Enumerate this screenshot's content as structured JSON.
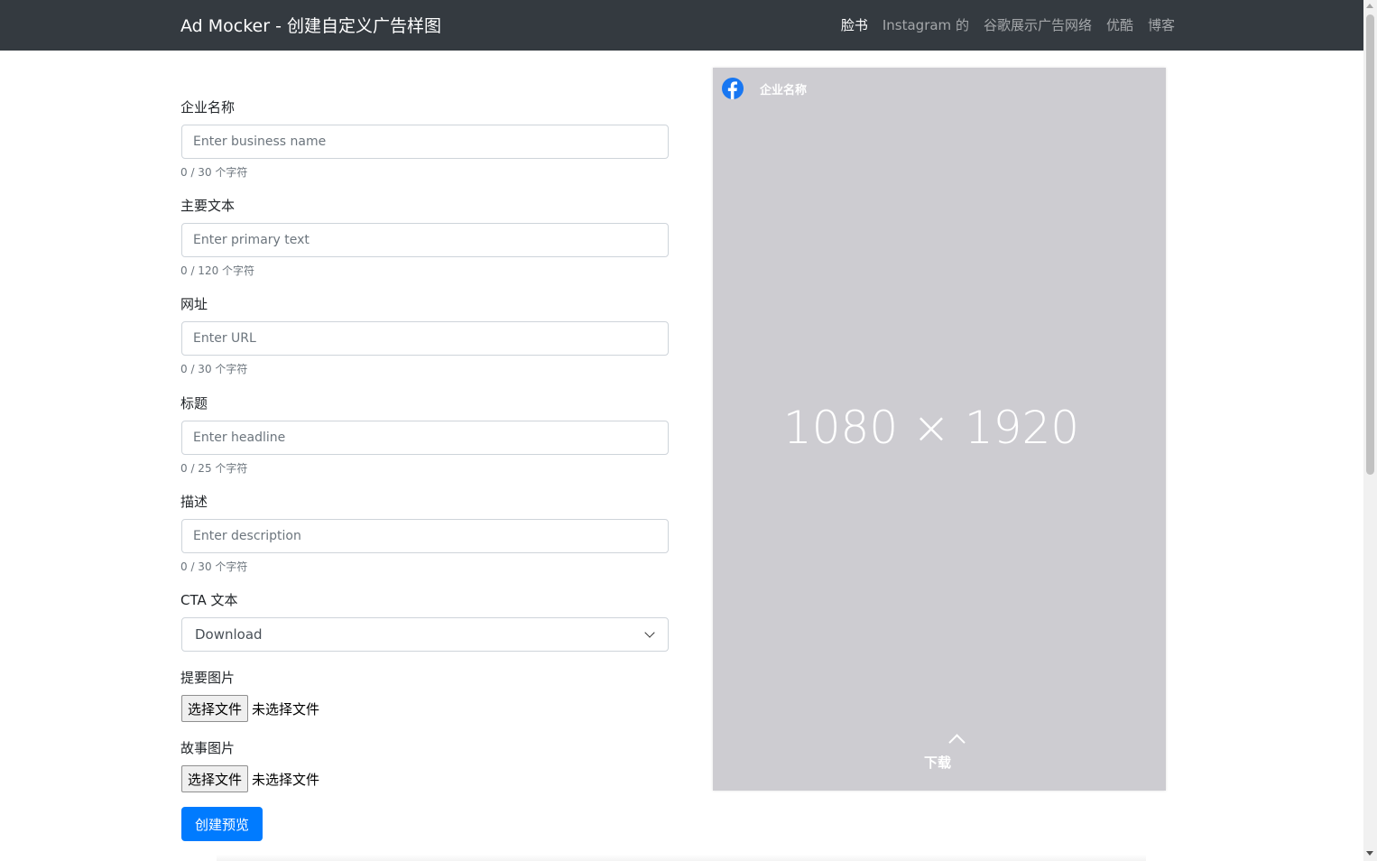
{
  "navbar": {
    "brand": "Ad Mocker - 创建自定义广告样图",
    "links": [
      {
        "label": "脸书",
        "active": true
      },
      {
        "label": "Instagram 的",
        "active": false
      },
      {
        "label": "谷歌展示广告网络",
        "active": false
      },
      {
        "label": "优酷",
        "active": false
      },
      {
        "label": "博客",
        "active": false
      }
    ]
  },
  "form": {
    "business_name": {
      "label": "企业名称",
      "placeholder": "Enter business name",
      "counter": "0 / 30 个字符"
    },
    "primary_text": {
      "label": "主要文本",
      "placeholder": "Enter primary text",
      "counter": "0 / 120 个字符"
    },
    "url": {
      "label": "网址",
      "placeholder": "Enter URL",
      "counter": "0 / 30 个字符"
    },
    "headline": {
      "label": "标题",
      "placeholder": "Enter headline",
      "counter": "0 / 25 个字符"
    },
    "description": {
      "label": "描述",
      "placeholder": "Enter description",
      "counter": "0 / 30 个字符"
    },
    "cta": {
      "label": "CTA 文本",
      "selected": "Download"
    },
    "summary_image": {
      "label": "提要图片",
      "button": "选择文件",
      "status": "未选择文件"
    },
    "story_image": {
      "label": "故事图片",
      "button": "选择文件",
      "status": "未选择文件"
    },
    "submit": "创建预览"
  },
  "preview": {
    "business_name": "企业名称",
    "dimension": "1080 × 1920",
    "cta": "下载",
    "colors": {
      "background": "#cdccd1",
      "facebook_blue": "#1877f2"
    }
  },
  "colors": {
    "navbar": "#343a40",
    "primary": "#007bff"
  }
}
